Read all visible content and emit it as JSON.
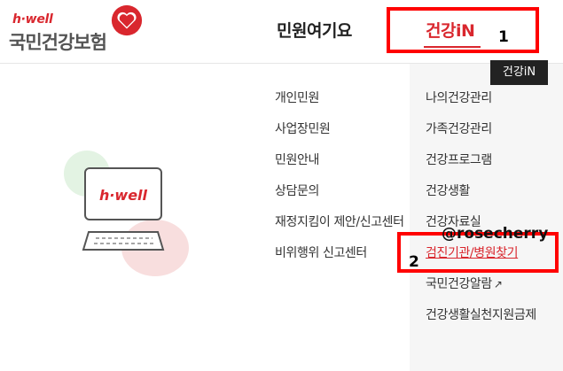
{
  "logo": {
    "brand": "h·well",
    "name": "국민건강보험"
  },
  "nav": {
    "minwon": "민원여기요",
    "health": "건강iN"
  },
  "tooltip": "건강iN",
  "annotations": {
    "box1_number": "1",
    "box2_number": "2",
    "watermark": "@rosecherry"
  },
  "menu_minwon": [
    "개인민원",
    "사업장민원",
    "민원안내",
    "상담문의",
    "재정지킴이 제안/신고센터",
    "비위행위 신고센터"
  ],
  "menu_health": [
    "나의건강관리",
    "가족건강관리",
    "건강프로그램",
    "건강생활",
    "건강자료실",
    "검진기관/병원찾기",
    "국민건강알람",
    "건강생활실천지원금제"
  ],
  "illustration": {
    "screen_text": "h·well"
  },
  "colors": {
    "brand_red": "#d9272e",
    "annotation_red": "#ff0000",
    "panel_gray": "#f6f6f6"
  }
}
